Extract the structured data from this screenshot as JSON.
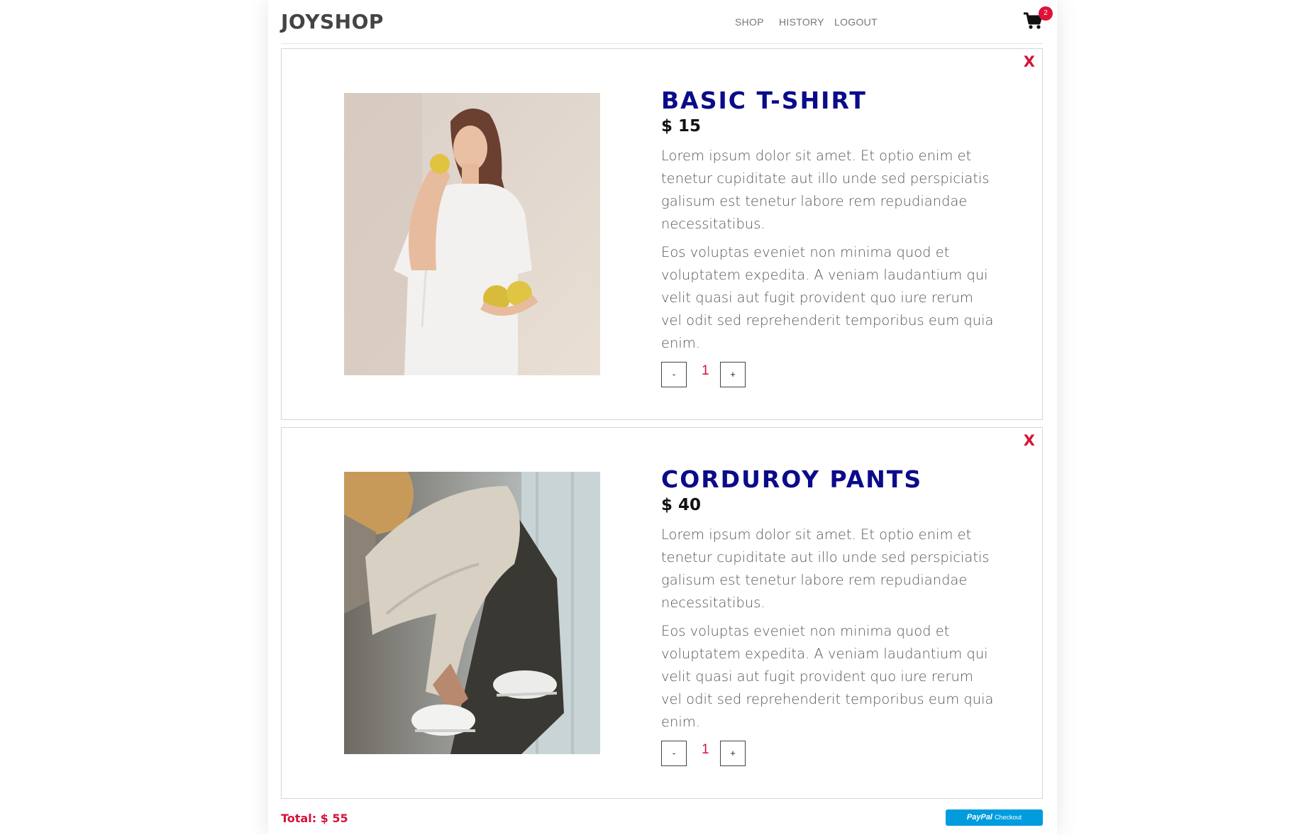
{
  "header": {
    "brand": "JOYSHOP",
    "nav": [
      {
        "label": "SHOP"
      },
      {
        "label": "HISTORY"
      },
      {
        "label": "LOGOUT"
      }
    ],
    "cart_count": "2",
    "cart_icon": "shopping-cart-icon"
  },
  "cart_items": [
    {
      "remove_label": "X",
      "name": "BASIC T-SHIRT",
      "price": "$ 15",
      "description_1": "Lorem ipsum dolor sit amet. Et optio enim et tenetur cupiditate aut illo unde sed perspiciatis galisum est tenetur labore rem repudiandae necessitatibus.",
      "description_2": "Eos voluptas eveniet non minima quod et voluptatem expedita. A veniam laudantium qui velit quasi aut fugit provident quo iure rerum vel odit sed reprehenderit temporibus eum quia enim.",
      "decrease_label": "-",
      "quantity": "1",
      "increase_label": "+"
    },
    {
      "remove_label": "X",
      "name": "CORDUROY PANTS",
      "price": "$ 40",
      "description_1": "Lorem ipsum dolor sit amet. Et optio enim et tenetur cupiditate aut illo unde sed perspiciatis galisum est tenetur labore rem repudiandae necessitatibus.",
      "description_2": "Eos voluptas eveniet non minima quod et voluptatem expedita. A veniam laudantium qui velit quasi aut fugit provident quo iure rerum vel odit sed reprehenderit temporibus eum quia enim.",
      "decrease_label": "-",
      "quantity": "1",
      "increase_label": "+"
    }
  ],
  "footer": {
    "total": "Total: $ 55",
    "paypal_brand": "PayPal",
    "paypal_label": "Checkout"
  },
  "colors": {
    "brand_text": "#444444",
    "product_title": "#0b0b8a",
    "accent_red": "#d6123a",
    "paypal_blue": "#009cde"
  }
}
